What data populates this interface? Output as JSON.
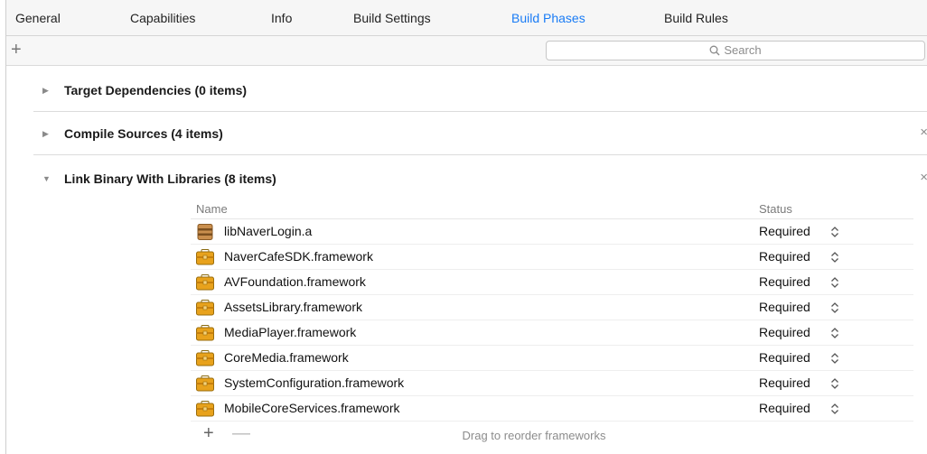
{
  "tabs": [
    {
      "label": "General"
    },
    {
      "label": "Capabilities"
    },
    {
      "label": "Info"
    },
    {
      "label": "Build Settings"
    },
    {
      "label": "Build Phases",
      "active": true
    },
    {
      "label": "Build Rules"
    }
  ],
  "toolbar": {
    "add_label": "+",
    "search_placeholder": "Search"
  },
  "sections": [
    {
      "title": "Target Dependencies (0 items)",
      "expanded": false,
      "closable": false
    },
    {
      "title": "Compile Sources (4 items)",
      "expanded": false,
      "closable": true
    },
    {
      "title": "Link Binary With Libraries (8 items)",
      "expanded": true,
      "closable": true
    }
  ],
  "libraries": {
    "columns": {
      "name": "Name",
      "status": "Status"
    },
    "rows": [
      {
        "name": "libNaverLogin.a",
        "status": "Required",
        "icon": "library-icon"
      },
      {
        "name": "NaverCafeSDK.framework",
        "status": "Required",
        "icon": "framework-icon"
      },
      {
        "name": "AVFoundation.framework",
        "status": "Required",
        "icon": "framework-icon"
      },
      {
        "name": "AssetsLibrary.framework",
        "status": "Required",
        "icon": "framework-icon"
      },
      {
        "name": "MediaPlayer.framework",
        "status": "Required",
        "icon": "framework-icon"
      },
      {
        "name": "CoreMedia.framework",
        "status": "Required",
        "icon": "framework-icon"
      },
      {
        "name": "SystemConfiguration.framework",
        "status": "Required",
        "icon": "framework-icon"
      },
      {
        "name": "MobileCoreServices.framework",
        "status": "Required",
        "icon": "framework-icon"
      }
    ],
    "footer": {
      "add_label": "+",
      "remove_label": "—",
      "hint": "Drag to reorder frameworks"
    }
  },
  "colors": {
    "accent": "#1a7cf5",
    "framework_icon": "#e8a21c"
  }
}
